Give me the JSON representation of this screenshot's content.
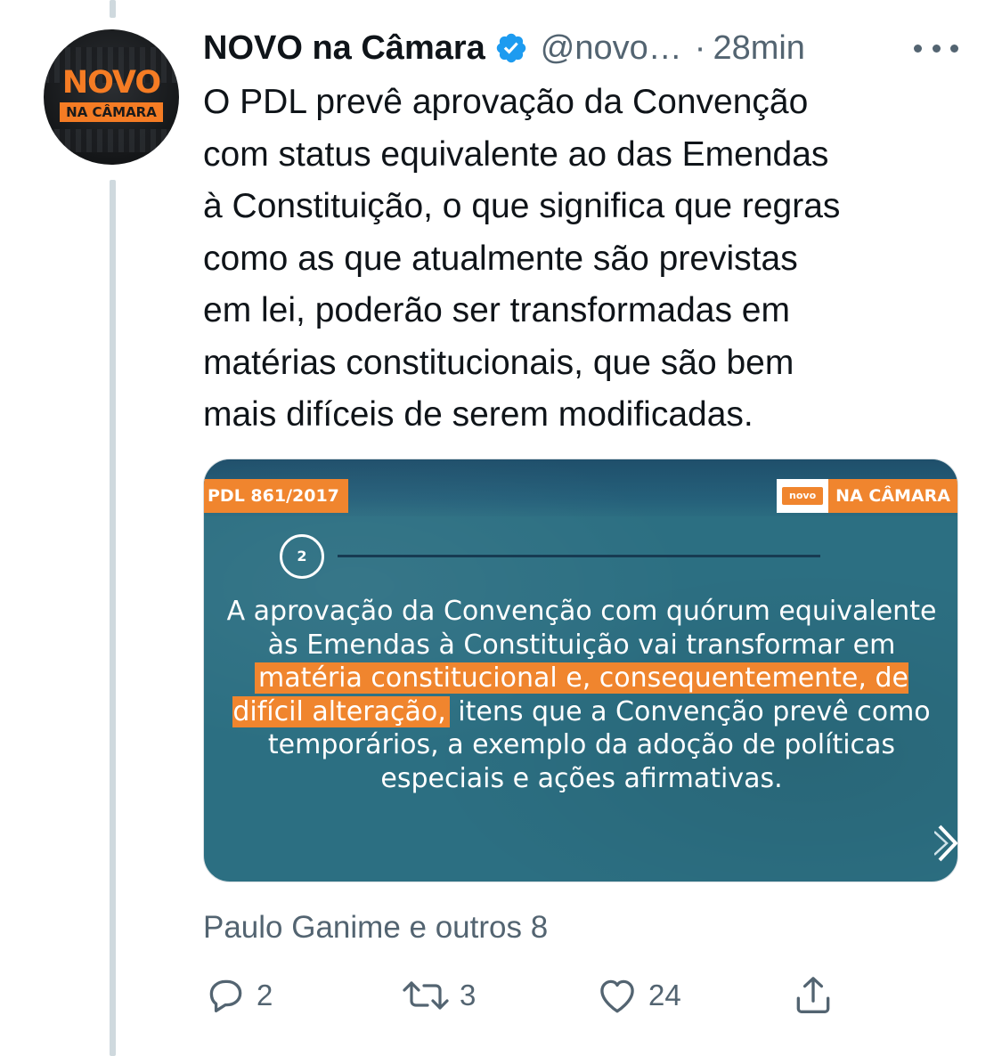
{
  "tweet": {
    "author_name": "NOVO na Câmara",
    "handle": "@novo…",
    "separator": "·",
    "time": "28min",
    "text": "O PDL prevê aprovação da Convenção\ncom status equivalente ao das Emendas\nà Constituição, o que significa que regras\ncomo as que atualmente são previstas\nem lei, poderão ser transformadas em\nmatérias constitucionais, que são bem\nmais difíceis de serem modificadas.",
    "avatar": {
      "logo_top": "NOVO",
      "logo_bottom": "NA CÂMARA"
    },
    "media": {
      "tag": "PDL 861/2017",
      "brand_small": "novo",
      "brand": "NA CÂMARA",
      "step": "2",
      "text_before": "A aprovação da Convenção com quórum equivalente às Emendas à Constituição vai transformar em ",
      "text_highlight": "matéria constitucional e, consequentemente, de difícil alteração,",
      "text_after": " itens que a Convenção prevê como temporários, a exemplo da adoção de políticas especiais e ações afirmativas."
    },
    "social_context": "Paulo Ganime e outros 8",
    "actions": {
      "reply_count": "2",
      "retweet_count": "3",
      "like_count": "24"
    },
    "icons": {
      "verified": "verified-badge-icon",
      "more": "more-icon",
      "reply": "reply-icon",
      "retweet": "retweet-icon",
      "like": "heart-icon",
      "share": "share-icon",
      "next": "chevron-right-icon"
    },
    "colors": {
      "verified": "#1d9bf0",
      "secondary_text": "#536471",
      "brand_orange": "#f0852e",
      "card_bg": "#2c6f82"
    }
  }
}
